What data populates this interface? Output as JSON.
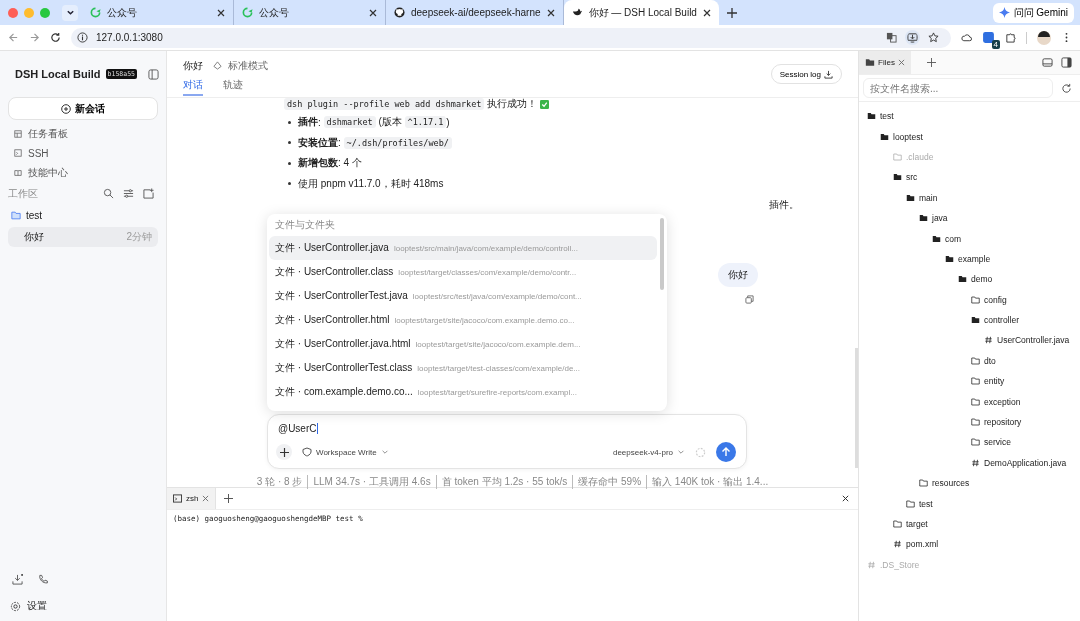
{
  "browser": {
    "tabs": [
      {
        "title": "公众号",
        "selected": false
      },
      {
        "title": "公众号",
        "selected": false
      },
      {
        "title": "deepseek-ai/deepseek-harne",
        "selected": false
      },
      {
        "title": "你好 — DSH Local Build",
        "selected": true
      }
    ],
    "gemini": "问问 Gemini",
    "url": "127.0.0.1:3080",
    "extension_badge": "4"
  },
  "sidebar": {
    "app_name": "DSH Local Build",
    "build": "b158a55",
    "new_chat": "新会话",
    "nav": [
      {
        "label": "任务看板"
      },
      {
        "label": "SSH"
      },
      {
        "label": "技能中心"
      }
    ],
    "workspace_label": "工作区",
    "folder": "test",
    "sessions": [
      {
        "title": "你好",
        "time": "2分钟",
        "selected": true
      }
    ],
    "settings": "设置"
  },
  "header": {
    "title": "你好",
    "mode": "标准模式",
    "tabs": [
      {
        "label": "对话",
        "selected": true
      },
      {
        "label": "轨迹",
        "selected": false
      }
    ],
    "session_log": "Session log"
  },
  "message": {
    "command": "dsh plugin --profile web add dshmarket",
    "result": "执行成功！",
    "bullets": [
      [
        {
          "kind": "bold",
          "text": "插件"
        },
        {
          "kind": "text",
          "text": ": "
        },
        {
          "kind": "code",
          "text": "dshmarket"
        },
        {
          "kind": "text",
          "text": " (版本 "
        },
        {
          "kind": "code",
          "text": "^1.17.1"
        },
        {
          "kind": "text",
          "text": ")"
        }
      ],
      [
        {
          "kind": "bold",
          "text": "安装位置"
        },
        {
          "kind": "text",
          "text": ": "
        },
        {
          "kind": "code",
          "text": "~/.dsh/profiles/web/"
        }
      ],
      [
        {
          "kind": "bold",
          "text": "新增包数"
        },
        {
          "kind": "text",
          "text": ": 4 个"
        }
      ],
      [
        {
          "kind": "text",
          "text": "使用 pnpm v11.7.0，耗时 418ms"
        }
      ]
    ],
    "covered_tail": "插件。"
  },
  "mention_popup": {
    "heading": "文件与文件夹",
    "items": [
      {
        "label": "文件 · UserController.java",
        "path": "looptest/src/main/java/com/example/demo/controll...",
        "selected": true
      },
      {
        "label": "文件 · UserController.class",
        "path": "looptest/target/classes/com/example/demo/contr...",
        "selected": false
      },
      {
        "label": "文件 · UserControllerTest.java",
        "path": "looptest/src/test/java/com/example/demo/cont...",
        "selected": false
      },
      {
        "label": "文件 · UserController.html",
        "path": "looptest/target/site/jacoco/com.example.demo.co...",
        "selected": false
      },
      {
        "label": "文件 · UserController.java.html",
        "path": "looptest/target/site/jacoco/com.example.dem...",
        "selected": false
      },
      {
        "label": "文件 · UserControllerTest.class",
        "path": "looptest/target/test-classes/com/example/de...",
        "selected": false
      },
      {
        "label": "文件 · com.example.demo.co...",
        "path": "looptest/target/surefire-reports/com.exampl...",
        "selected": false
      }
    ]
  },
  "user_message": "你好",
  "composer": {
    "value": "@UserC",
    "permission": "Workspace Write",
    "model": "deepseek-v4-pro"
  },
  "stats": [
    "3 轮 · 8 步",
    "LLM 34.7s · 工具调用 4.6s",
    "首 token 平均 1.2s · 55 tok/s",
    "缓存命中 59%",
    "输入 140K tok · 输出 1.4..."
  ],
  "terminal": {
    "tab": "zsh",
    "prompt": "(base) gaoguosheng@gaoguoshengdeMBP test %"
  },
  "files": {
    "tab": "Files",
    "search_placeholder": "按文件名搜索...",
    "tree": [
      {
        "name": "test",
        "kind": "folder",
        "expanded": true,
        "muted": false,
        "children": [
          {
            "name": "looptest",
            "kind": "folder",
            "expanded": true,
            "muted": false,
            "children": [
              {
                "name": ".claude",
                "kind": "folder",
                "expanded": false,
                "muted": true
              },
              {
                "name": "src",
                "kind": "folder",
                "expanded": true,
                "muted": false,
                "children": [
                  {
                    "name": "main",
                    "kind": "folder",
                    "expanded": true,
                    "muted": false,
                    "children": [
                      {
                        "name": "java",
                        "kind": "folder",
                        "expanded": true,
                        "muted": false,
                        "children": [
                          {
                            "name": "com",
                            "kind": "folder",
                            "expanded": true,
                            "muted": false,
                            "children": [
                              {
                                "name": "example",
                                "kind": "folder",
                                "expanded": true,
                                "muted": false,
                                "children": [
                                  {
                                    "name": "demo",
                                    "kind": "folder",
                                    "expanded": true,
                                    "muted": false,
                                    "children": [
                                      {
                                        "name": "config",
                                        "kind": "folder",
                                        "expanded": false,
                                        "muted": false
                                      },
                                      {
                                        "name": "controller",
                                        "kind": "folder",
                                        "expanded": true,
                                        "muted": false,
                                        "children": [
                                          {
                                            "name": "UserController.java",
                                            "kind": "file",
                                            "muted": false
                                          }
                                        ]
                                      },
                                      {
                                        "name": "dto",
                                        "kind": "folder",
                                        "expanded": false,
                                        "muted": false
                                      },
                                      {
                                        "name": "entity",
                                        "kind": "folder",
                                        "expanded": false,
                                        "muted": false
                                      },
                                      {
                                        "name": "exception",
                                        "kind": "folder",
                                        "expanded": false,
                                        "muted": false
                                      },
                                      {
                                        "name": "repository",
                                        "kind": "folder",
                                        "expanded": false,
                                        "muted": false
                                      },
                                      {
                                        "name": "service",
                                        "kind": "folder",
                                        "expanded": false,
                                        "muted": false
                                      },
                                      {
                                        "name": "DemoApplication.java",
                                        "kind": "file",
                                        "muted": false
                                      }
                                    ]
                                  }
                                ]
                              }
                            ]
                          }
                        ]
                      },
                      {
                        "name": "resources",
                        "kind": "folder",
                        "expanded": false,
                        "muted": false
                      }
                    ]
                  },
                  {
                    "name": "test",
                    "kind": "folder",
                    "expanded": false,
                    "muted": false
                  }
                ]
              },
              {
                "name": "target",
                "kind": "folder",
                "expanded": false,
                "muted": false
              },
              {
                "name": "pom.xml",
                "kind": "file",
                "muted": false
              }
            ]
          }
        ]
      },
      {
        "name": ".DS_Store",
        "kind": "file",
        "muted": true
      }
    ]
  }
}
